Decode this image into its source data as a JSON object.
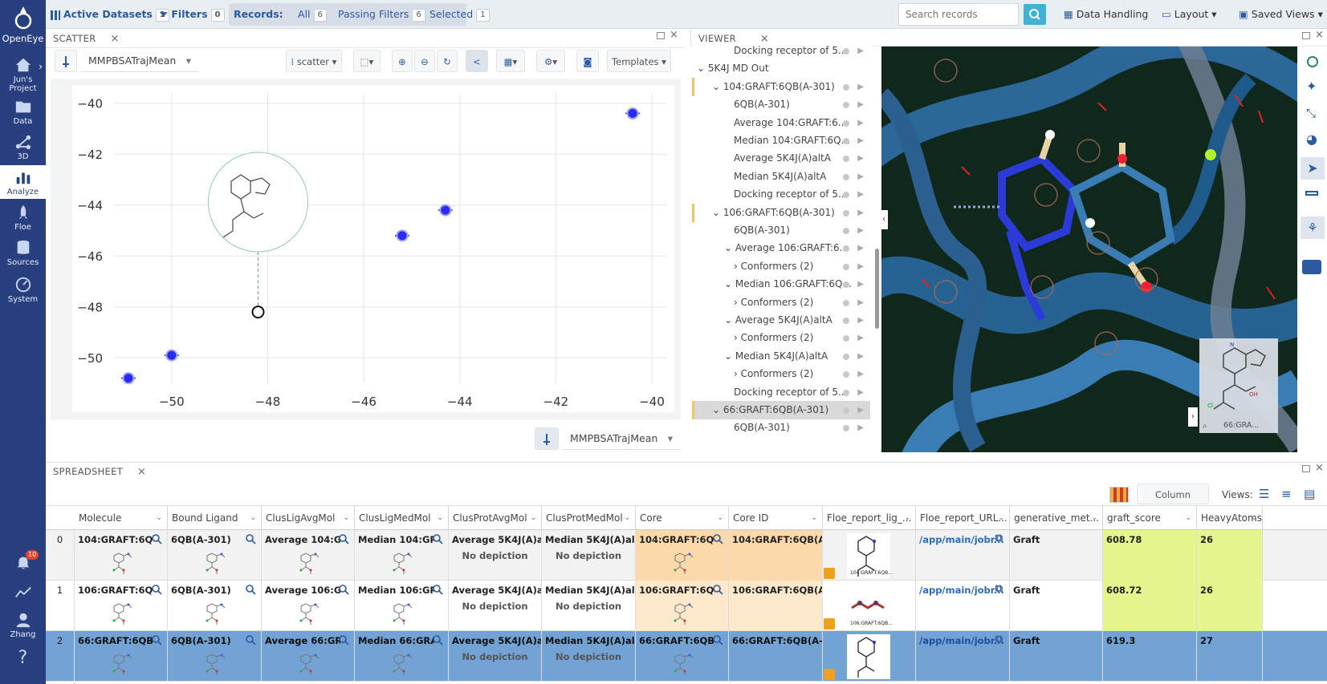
{
  "app": {
    "name": "OpenEye"
  },
  "nav": [
    {
      "label": "Jun's Project",
      "icon": "home-icon"
    },
    {
      "label": "Data",
      "icon": "folder-icon"
    },
    {
      "label": "3D",
      "icon": "molecule-3d-icon"
    },
    {
      "label": "Analyze",
      "icon": "bar-chart-icon",
      "active": true
    },
    {
      "label": "Floe",
      "icon": "rocket-icon"
    },
    {
      "label": "Sources",
      "icon": "database-icon"
    },
    {
      "label": "System",
      "icon": "gauge-icon"
    },
    {
      "label": "",
      "icon": "bell-icon",
      "badge": "10"
    },
    {
      "label": "",
      "icon": "activity-icon"
    },
    {
      "label": "Zhang",
      "icon": "user-icon"
    },
    {
      "label": "?",
      "icon": "help-icon"
    }
  ],
  "toolbar": {
    "active_datasets": "Active Datasets",
    "active_datasets_count": "1",
    "filters": "Filters",
    "filters_count": "0",
    "records": "Records:",
    "all": "All",
    "all_count": "6",
    "passing": "Passing Filters",
    "passing_count": "6",
    "selected": "Selected",
    "selected_count": "1",
    "search_placeholder": "Search records",
    "data_handling": "Data Handling",
    "layout": "Layout",
    "saved_views": "Saved Views"
  },
  "scatter": {
    "tab": "SCATTER",
    "y_field": "MMPBSATrajMean",
    "x_field": "MMPBSATrajMean",
    "plot_type": "scatter",
    "templates": "Templates"
  },
  "chart_data": {
    "type": "scatter",
    "title": "",
    "xlabel": "",
    "ylabel": "",
    "xlim": [
      -51.2,
      -39.7
    ],
    "ylim": [
      -51.0,
      -39.6
    ],
    "x_ticks": [
      "−50",
      "−48",
      "−46",
      "−44",
      "−42",
      "−40"
    ],
    "y_ticks": [
      "−40",
      "−42",
      "−44",
      "−46",
      "−48",
      "−50"
    ],
    "grid": true,
    "points": [
      {
        "x": -40.4,
        "y": -40.4
      },
      {
        "x": -44.3,
        "y": -44.2
      },
      {
        "x": -45.2,
        "y": -45.2
      },
      {
        "x": -48.2,
        "y": -48.2,
        "highlighted": true
      },
      {
        "x": -50.0,
        "y": -49.9
      },
      {
        "x": -50.9,
        "y": -50.8
      }
    ]
  },
  "viewer": {
    "tab": "VIEWER",
    "tree": [
      {
        "label": "Docking receptor of 5...",
        "level": 3
      },
      {
        "label": "5K4J MD Out",
        "level": 0,
        "caret": "⌄"
      },
      {
        "label": "104:GRAFT:6QB(A-301)",
        "level": 1,
        "caret": "⌄"
      },
      {
        "label": "6QB(A-301)",
        "level": 3
      },
      {
        "label": "Average 104:GRAFT:6...",
        "level": 3
      },
      {
        "label": "Median 104:GRAFT:6Q...",
        "level": 3
      },
      {
        "label": "Average 5K4J(A)altA",
        "level": 3
      },
      {
        "label": "Median 5K4J(A)altA",
        "level": 3
      },
      {
        "label": "Docking receptor of 5...",
        "level": 3
      },
      {
        "label": "106:GRAFT:6QB(A-301)",
        "level": 1,
        "caret": "⌄"
      },
      {
        "label": "6QB(A-301)",
        "level": 3
      },
      {
        "label": "Average 106:GRAFT:6...",
        "level": 2,
        "caret": "⌄"
      },
      {
        "label": "Conformers (2)",
        "level": 3,
        "caret": "›"
      },
      {
        "label": "Median 106:GRAFT:6Q...",
        "level": 2,
        "caret": "⌄"
      },
      {
        "label": "Conformers (2)",
        "level": 3,
        "caret": "›"
      },
      {
        "label": "Average 5K4J(A)altA",
        "level": 2,
        "caret": "⌄"
      },
      {
        "label": "Conformers (2)",
        "level": 3,
        "caret": "›"
      },
      {
        "label": "Median 5K4J(A)altA",
        "level": 2,
        "caret": "⌄"
      },
      {
        "label": "Conformers (2)",
        "level": 3,
        "caret": "›"
      },
      {
        "label": "Docking receptor of 5...",
        "level": 3
      },
      {
        "label": "66:GRAFT:6QB(A-301)",
        "level": 1,
        "caret": "⌄",
        "selected": true
      },
      {
        "label": "6QB(A-301)",
        "level": 3
      }
    ],
    "inset_label": "66:GRA..."
  },
  "spreadsheet": {
    "tab": "SPREADSHEET",
    "column_options": "Column Options",
    "views_label": "Views:",
    "columns": [
      "Molecule",
      "Bound Ligand",
      "ClusLigAvgMol",
      "ClusLigMedMol",
      "ClusProtAvgMol",
      "ClusProtMedMol",
      "Core",
      "Core ID",
      "Floe_report_lig_...",
      "Floe_report_URL...",
      "generative_met...",
      "graft_score",
      "HeavyAtoms"
    ],
    "rows": [
      {
        "idx": "0",
        "molecule": "104:GRAFT:6QB(...",
        "bound": "6QB(A-301)",
        "cla": "Average 104:GRA...",
        "clm": "Median 104:GRA...",
        "cpa": "Average 5K4J(A)a...",
        "cpm": "Median 5K4J(A)al...",
        "nodep": "No depiction",
        "core": "104:GRAFT:6QB(...",
        "coreid": "104:GRAFT:6QB(A-...",
        "floe_lig_caption": "104:GRAFT:6QB...",
        "url": "/app/main/jobr...",
        "gen": "Graft",
        "score": "608.78",
        "heavy": "26"
      },
      {
        "idx": "1",
        "molecule": "106:GRAFT:6QB(...",
        "bound": "6QB(A-301)",
        "cla": "Average 106:GRA...",
        "clm": "Median 106:GRA...",
        "cpa": "Average 5K4J(A)a...",
        "cpm": "Median 5K4J(A)al...",
        "nodep": "No depiction",
        "core": "106:GRAFT:6QB(...",
        "coreid": "106:GRAFT:6QB(A-...",
        "floe_lig_caption": "106:GRAFT:6QB...",
        "url": "/app/main/jobr...",
        "gen": "Graft",
        "score": "608.72",
        "heavy": "26"
      },
      {
        "idx": "2",
        "molecule": "66:GRAFT:6QB(A-...",
        "bound": "6QB(A-301)",
        "cla": "Average 66:GRAF...",
        "clm": "Median 66:GRAF...",
        "cpa": "Average 5K4J(A)a...",
        "cpm": "Median 5K4J(A)al...",
        "nodep": "No depiction",
        "core": "66:GRAFT:6QB(A-...",
        "coreid": "66:GRAFT:6QB(A-3...",
        "floe_lig_caption": "",
        "url": "/app/main/jobr...",
        "gen": "Graft",
        "score": "619.3",
        "heavy": "27"
      }
    ],
    "colors": {
      "score_bg": "#e6f58c",
      "core_bg": "#fde1bb",
      "selected_row": "#72a3d4"
    }
  }
}
